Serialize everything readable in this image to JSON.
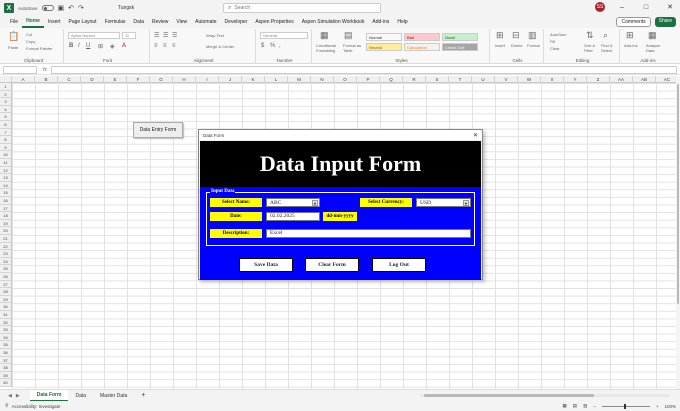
{
  "titlebar": {
    "autosave_label": "AutoSave",
    "doc_title": "Tungsk",
    "search_placeholder": "Search",
    "avatar_initials": "SS"
  },
  "menu": {
    "items": [
      "File",
      "Home",
      "Insert",
      "Page Layout",
      "Formulas",
      "Data",
      "Review",
      "View",
      "Automate",
      "Developer",
      "Aspen Properties",
      "Aspen Simulation Workbook",
      "Add-ins",
      "Help"
    ],
    "active": "Home",
    "comments_label": "Comments",
    "share_label": "Share"
  },
  "ribbon": {
    "groups": [
      "Clipboard",
      "Font",
      "Alignment",
      "Number",
      "Styles",
      "Cells",
      "Editing",
      "Add-ins"
    ],
    "font_name": "Aptos Narrow",
    "font_size": "11",
    "number_format": "General",
    "wrap_text": "Wrap Text",
    "merge_center": "Merge & Center",
    "cond_format": "Conditional Formatting",
    "format_table": "Format as Table",
    "styles": [
      {
        "label": "Normal",
        "bg": "#ffffff"
      },
      {
        "label": "Bad",
        "bg": "#ffc7ce"
      },
      {
        "label": "Good",
        "bg": "#c6efce"
      },
      {
        "label": "Neutral",
        "bg": "#ffeb9c"
      },
      {
        "label": "Calculation",
        "bg": "#f2f2f2"
      },
      {
        "label": "Check Cell",
        "bg": "#a5a5a5"
      }
    ],
    "insert": "Insert",
    "delete": "Delete",
    "format": "Format",
    "autosum": "AutoSum",
    "fill": "Fill",
    "clear": "Clear",
    "sort_filter": "Sort & Filter",
    "find_select": "Find & Select",
    "addins": "Add-ins",
    "analyze": "Analyze Data",
    "paste": "Paste",
    "cut": "Cut",
    "copy": "Copy",
    "format_painter": "Format Painter"
  },
  "formula_bar": {
    "cell_ref": "",
    "fx": "fx",
    "value": ""
  },
  "grid": {
    "columns": [
      "A",
      "B",
      "C",
      "D",
      "E",
      "F",
      "G",
      "H",
      "I",
      "J",
      "K",
      "L",
      "M",
      "N",
      "O",
      "P",
      "Q",
      "R",
      "S",
      "T",
      "U",
      "V",
      "W",
      "X",
      "Y",
      "Z",
      "AA",
      "AB",
      "AC"
    ],
    "rows": [
      1,
      2,
      3,
      4,
      5,
      6,
      7,
      8,
      9,
      10,
      11,
      12,
      13,
      14,
      15,
      16,
      17,
      18,
      19,
      20,
      21,
      22,
      23,
      24,
      25,
      26,
      27,
      28,
      29,
      30,
      31,
      32,
      33,
      34,
      35,
      36,
      37,
      38,
      39,
      40
    ]
  },
  "sheet_button": "Data Entry Form",
  "dialog": {
    "window_title": "Data Form",
    "header": "Data Input Form",
    "frame_title": "Input Data",
    "select_name_label": "Select Name:",
    "select_name_value": "ABC",
    "currency_label": "Select Currency:",
    "currency_value": "USD",
    "date_label": "Date:",
    "date_value": "02.02.2025",
    "date_hint": "dd-mm-yyyy",
    "description_label": "Description:",
    "description_value": "Excel",
    "save_label": "Save Data",
    "clear_label": "Clear Form",
    "logout_label": "Log Out"
  },
  "tabs": {
    "sheets": [
      "Data Form",
      "Data",
      "Master Data"
    ],
    "active": "Data Form"
  },
  "status": {
    "accessibility": "Accessibility: Investigate",
    "zoom": "100%"
  },
  "colors": {
    "excel_green": "#1d6f42",
    "form_blue": "#0000ff",
    "label_yellow": "#ffff00",
    "header_black": "#000000"
  }
}
